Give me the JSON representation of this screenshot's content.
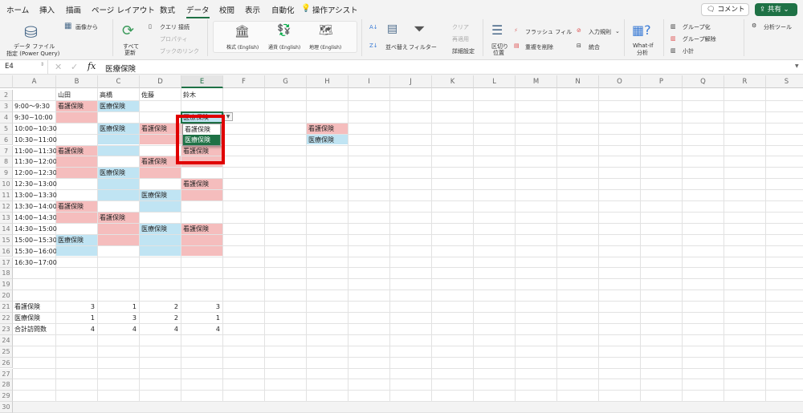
{
  "tabs": [
    "ホーム",
    "挿入",
    "描画",
    "ページ レイアウト",
    "数式",
    "データ",
    "校閲",
    "表示",
    "自動化",
    "操作アシスト"
  ],
  "active_tab": "データ",
  "header_buttons": {
    "comment": "コメント",
    "share": "共有"
  },
  "ribbon": {
    "get_data": "データ ファイル",
    "get_data2": "指定 (Power Query)",
    "from_picture": "画像から",
    "refresh_all": "すべて",
    "refresh_all2": "更新",
    "queries": "クエリ",
    "connections": "接続",
    "properties": "プロパティ",
    "workbook_links": "ブックのリンク",
    "stocks": "株式 (English)",
    "currencies": "通貨 (English)",
    "geography": "地理 (English)",
    "sort": "並べ替え",
    "filter": "フィルター",
    "clear": "クリア",
    "reapply": "再適用",
    "advanced": "詳細設定",
    "text_to_columns": "区切り",
    "text_to_columns2": "位置",
    "flash_fill": "フラッシュ フィル",
    "remove_duplicates": "重複を削除",
    "data_validation": "入力規則",
    "consolidate": "統合",
    "what_if": "What-If",
    "what_if2": "分析",
    "group": "グループ化",
    "ungroup": "グループ解除",
    "subtotal": "小計",
    "analysis_tools": "分析ツール"
  },
  "formula_bar": {
    "name_box": "E4",
    "fx": "fx",
    "value": "医療保険"
  },
  "columns": [
    "A",
    "B",
    "C",
    "D",
    "E",
    "F",
    "G",
    "H",
    "I",
    "J",
    "K",
    "L",
    "M",
    "N",
    "O",
    "P",
    "Q",
    "R",
    "S"
  ],
  "selected_column": "E",
  "first_row": 2,
  "last_row": 30,
  "colors": {
    "pink": "#f5bdbd",
    "blue": "#c0e4f3",
    "accent": "#1e7145",
    "highlight_box": "#e00000"
  },
  "cells": [
    {
      "ref": "B2",
      "text": "山田"
    },
    {
      "ref": "C2",
      "text": "高橋"
    },
    {
      "ref": "D2",
      "text": "佐藤"
    },
    {
      "ref": "E2",
      "text": "鈴木"
    },
    {
      "ref": "A3",
      "text": "9:00～9:30"
    },
    {
      "ref": "A4",
      "text": "9:30~10:00"
    },
    {
      "ref": "A5",
      "text": "10:00~10:30"
    },
    {
      "ref": "A6",
      "text": "10:30~11:00"
    },
    {
      "ref": "A7",
      "text": "11:00~11:30"
    },
    {
      "ref": "A8",
      "text": "11:30~12:00"
    },
    {
      "ref": "A9",
      "text": "12:00~12:30"
    },
    {
      "ref": "A10",
      "text": "12:30~13:00"
    },
    {
      "ref": "A11",
      "text": "13:00~13:30"
    },
    {
      "ref": "A12",
      "text": "13:30~14:00"
    },
    {
      "ref": "A13",
      "text": "14:00~14:30"
    },
    {
      "ref": "A14",
      "text": "14:30~15:00"
    },
    {
      "ref": "A15",
      "text": "15:00~15:30"
    },
    {
      "ref": "A16",
      "text": "15:30~16:00"
    },
    {
      "ref": "A17",
      "text": "16:30~17:00"
    },
    {
      "ref": "B3",
      "text": "看護保険",
      "fill": "pink"
    },
    {
      "ref": "B4",
      "text": "",
      "fill": "pink"
    },
    {
      "ref": "C3",
      "text": "医療保険",
      "fill": "blue"
    },
    {
      "ref": "E4",
      "text": "医療保険",
      "fill": "blue"
    },
    {
      "ref": "C5",
      "text": "医療保険",
      "fill": "blue"
    },
    {
      "ref": "C6",
      "text": "",
      "fill": "blue"
    },
    {
      "ref": "C7",
      "text": "",
      "fill": "blue"
    },
    {
      "ref": "D5",
      "text": "看護保険",
      "fill": "pink"
    },
    {
      "ref": "D6",
      "text": "",
      "fill": "pink"
    },
    {
      "ref": "E5",
      "text": "",
      "fill": "pink"
    },
    {
      "ref": "E6",
      "text": "",
      "fill": "pink"
    },
    {
      "ref": "E7",
      "text": "看護保険",
      "fill": "pink"
    },
    {
      "ref": "E8",
      "text": "",
      "fill": "pink"
    },
    {
      "ref": "H5",
      "text": "看護保険",
      "fill": "pink"
    },
    {
      "ref": "H6",
      "text": "医療保険",
      "fill": "blue"
    },
    {
      "ref": "B7",
      "text": "看護保険",
      "fill": "pink"
    },
    {
      "ref": "B8",
      "text": "",
      "fill": "pink"
    },
    {
      "ref": "B9",
      "text": "",
      "fill": "pink"
    },
    {
      "ref": "D8",
      "text": "看護保険",
      "fill": "pink"
    },
    {
      "ref": "D9",
      "text": "",
      "fill": "pink"
    },
    {
      "ref": "C9",
      "text": "医療保険",
      "fill": "blue"
    },
    {
      "ref": "C10",
      "text": "",
      "fill": "blue"
    },
    {
      "ref": "C11",
      "text": "",
      "fill": "blue"
    },
    {
      "ref": "E10",
      "text": "看護保険",
      "fill": "pink"
    },
    {
      "ref": "E11",
      "text": "",
      "fill": "pink"
    },
    {
      "ref": "D11",
      "text": "医療保険",
      "fill": "blue"
    },
    {
      "ref": "D12",
      "text": "",
      "fill": "blue"
    },
    {
      "ref": "B12",
      "text": "看護保険",
      "fill": "pink"
    },
    {
      "ref": "B13",
      "text": "",
      "fill": "pink"
    },
    {
      "ref": "C13",
      "text": "看護保険",
      "fill": "pink"
    },
    {
      "ref": "C14",
      "text": "",
      "fill": "pink"
    },
    {
      "ref": "C15",
      "text": "",
      "fill": "pink"
    },
    {
      "ref": "D14",
      "text": "医療保険",
      "fill": "blue"
    },
    {
      "ref": "D15",
      "text": "",
      "fill": "blue"
    },
    {
      "ref": "D16",
      "text": "",
      "fill": "blue"
    },
    {
      "ref": "E14",
      "text": "看護保険",
      "fill": "pink"
    },
    {
      "ref": "E15",
      "text": "",
      "fill": "pink"
    },
    {
      "ref": "E16",
      "text": "",
      "fill": "pink"
    },
    {
      "ref": "B15",
      "text": "医療保険",
      "fill": "blue"
    },
    {
      "ref": "B16",
      "text": "",
      "fill": "blue"
    },
    {
      "ref": "A21",
      "text": "看護保険"
    },
    {
      "ref": "B21",
      "text": "3",
      "num": true
    },
    {
      "ref": "C21",
      "text": "1",
      "num": true
    },
    {
      "ref": "D21",
      "text": "2",
      "num": true
    },
    {
      "ref": "E21",
      "text": "3",
      "num": true
    },
    {
      "ref": "A22",
      "text": "医療保険"
    },
    {
      "ref": "B22",
      "text": "1",
      "num": true
    },
    {
      "ref": "C22",
      "text": "3",
      "num": true
    },
    {
      "ref": "D22",
      "text": "2",
      "num": true
    },
    {
      "ref": "E22",
      "text": "1",
      "num": true
    },
    {
      "ref": "A23",
      "text": "合計訪問数"
    },
    {
      "ref": "B23",
      "text": "4",
      "num": true
    },
    {
      "ref": "C23",
      "text": "4",
      "num": true
    },
    {
      "ref": "D23",
      "text": "4",
      "num": true
    },
    {
      "ref": "E23",
      "text": "4",
      "num": true
    }
  ],
  "dropdown": {
    "options": [
      "看護保険",
      "医療保険"
    ],
    "selected": "医療保険"
  }
}
